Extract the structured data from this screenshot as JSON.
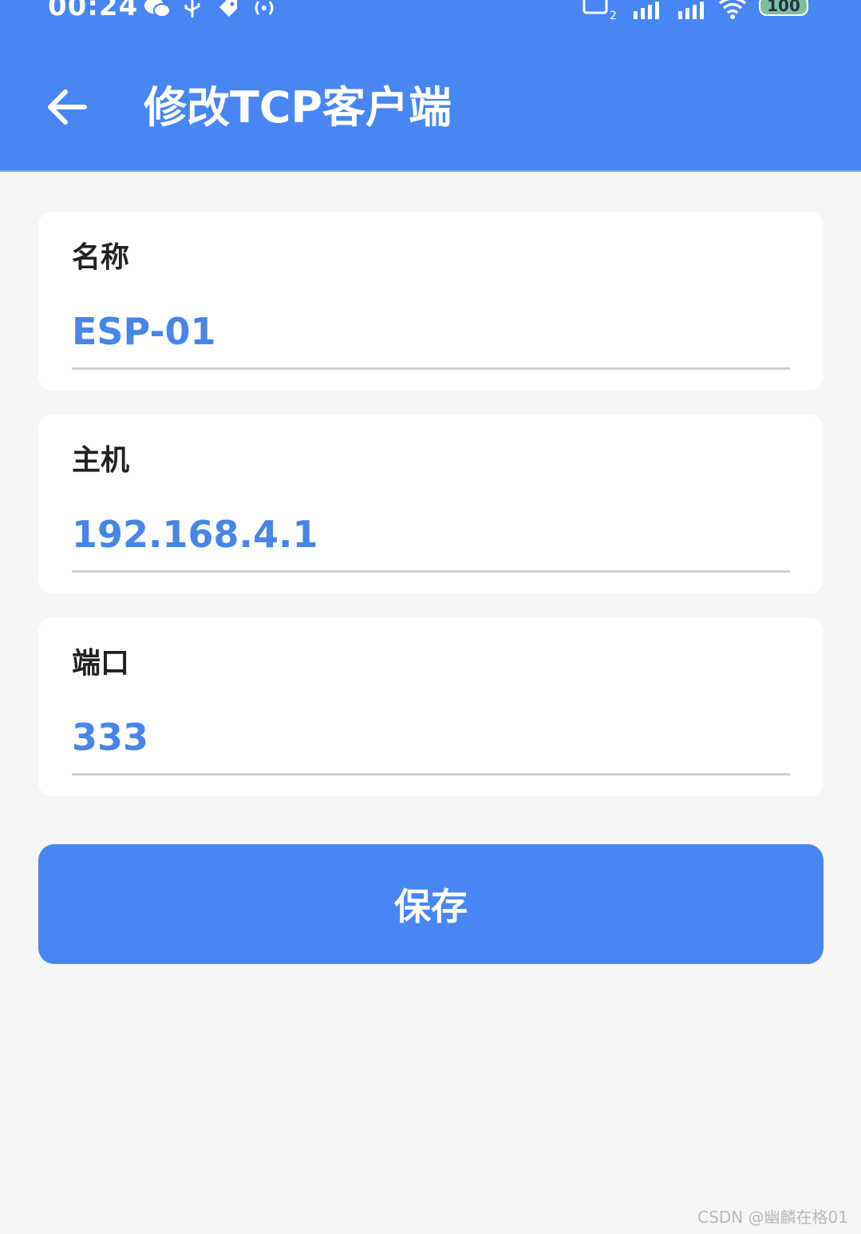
{
  "status_bar": {
    "time": "00:24",
    "battery": "100",
    "icons": [
      "wechat-icon",
      "usb-icon",
      "tag-icon",
      "hotspot-icon",
      "hd-icon",
      "signal-5g-icon",
      "signal-5g-icon",
      "wifi-icon",
      "battery-icon"
    ]
  },
  "header": {
    "title": "修改TCP客户端",
    "back_icon": "arrow-left-icon"
  },
  "form": {
    "name": {
      "label": "名称",
      "value": "ESP-01"
    },
    "host": {
      "label": "主机",
      "value": "192.168.4.1"
    },
    "port": {
      "label": "端口",
      "value": "333"
    }
  },
  "actions": {
    "save_label": "保存"
  },
  "watermark": "CSDN @幽麟在格01",
  "colors": {
    "primary": "#4886f4",
    "value_text": "#4786e8",
    "background": "#f6f6f6"
  }
}
